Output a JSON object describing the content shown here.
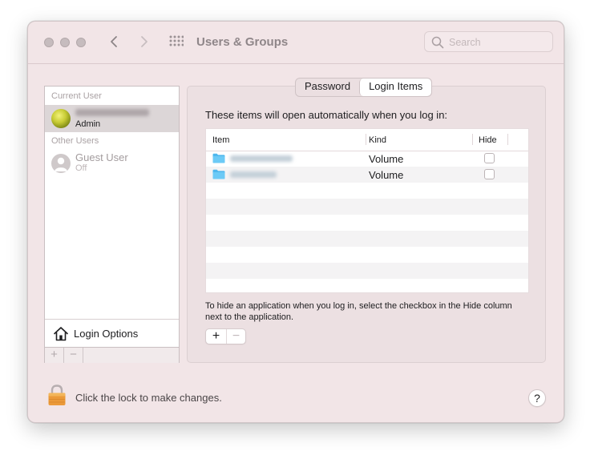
{
  "window": {
    "title": "Users & Groups",
    "search_placeholder": "Search"
  },
  "sidebar": {
    "current_user_label": "Current User",
    "current_user_role": "Admin",
    "other_users_label": "Other Users",
    "guest_user_name": "Guest User",
    "guest_user_status": "Off",
    "login_options_label": "Login Options",
    "add_button": "+",
    "remove_button": "−"
  },
  "tabs": [
    {
      "label": "Password",
      "active": false
    },
    {
      "label": "Login Items",
      "active": true
    }
  ],
  "login_items": {
    "intro": "These items will open automatically when you log in:",
    "columns": [
      "Item",
      "Kind",
      "Hide"
    ],
    "rows": [
      {
        "kind": "Volume",
        "hide": false
      },
      {
        "kind": "Volume",
        "hide": false
      }
    ],
    "hint": "To hide an application when you log in, select the checkbox in the Hide column next to the application.",
    "add_button": "+",
    "remove_button": "−"
  },
  "footer": {
    "lock_label": "Click the lock to make changes.",
    "help_button": "?"
  },
  "icons": {
    "folder": "folder-icon",
    "lock": "padlock-icon",
    "home": "house-icon",
    "search": "magnifier-icon",
    "grid": "grid-icon"
  },
  "colors": {
    "window_bg": "#f2e5e7",
    "folder_blue": "#4fb8ee",
    "lock_orange": "#eb9a3a"
  }
}
